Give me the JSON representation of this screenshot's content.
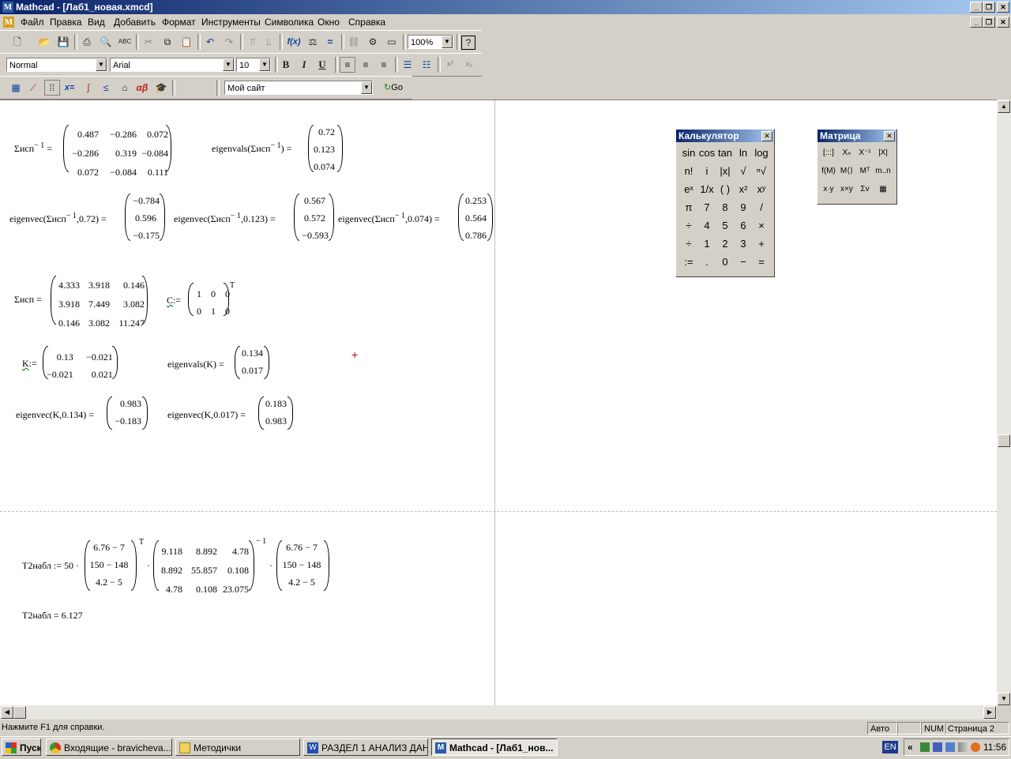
{
  "window": {
    "title": "Mathcad - [Лаб1_новая.xmcd]"
  },
  "menu": [
    "Файл",
    "Правка",
    "Вид",
    "Добавить",
    "Формат",
    "Инструменты",
    "Символика",
    "Окно",
    "Справка"
  ],
  "toolbar": {
    "zoom": "100%",
    "style": "Normal",
    "font": "Arial",
    "size": "10",
    "bold": "B",
    "italic": "I",
    "underline": "U",
    "resource": "Мой сайт",
    "go": "Go",
    "calc_glyph": "x=",
    "greek_glyph": "αβ"
  },
  "doc": {
    "sinv_label": "Σисп",
    "sinv_sup": "− 1",
    "eq": "=",
    "assign": ":=",
    "sinv_matrix": [
      [
        "0.487",
        "−0.286",
        "0.072"
      ],
      [
        "−0.286",
        "0.319",
        "−0.084"
      ],
      [
        "0.072",
        "−0.084",
        "0.111"
      ]
    ],
    "eigenvals_fn": "eigenvals",
    "eigenvals_vec": [
      "0.72",
      "0.123",
      "0.074"
    ],
    "eigenvec_fn": "eigenvec",
    "ev1_arg": ",0.72",
    "ev1_vec": [
      "−0.784",
      "0.596",
      "−0.175"
    ],
    "ev2_arg": ",0.123",
    "ev2_vec": [
      "0.567",
      "0.572",
      "−0.593"
    ],
    "ev3_arg": ",0.074",
    "ev3_vec": [
      "0.253",
      "0.564",
      "0.786"
    ],
    "s_label": "Σисп",
    "s_matrix": [
      [
        "4.333",
        "3.918",
        "0.146"
      ],
      [
        "3.918",
        "7.449",
        "3.082"
      ],
      [
        "0.146",
        "3.082",
        "11.247"
      ]
    ],
    "c_label": "C",
    "c_matrix": [
      [
        "1",
        "0",
        "0"
      ],
      [
        "0",
        "1",
        "0"
      ]
    ],
    "transpose": "T",
    "k_label": "K",
    "k_matrix": [
      [
        "0.13",
        "−0.021"
      ],
      [
        "−0.021",
        "0.021"
      ]
    ],
    "eigk_text": "eigenvals(K) =",
    "eigk_vec": [
      "0.134",
      "0.017"
    ],
    "evk1_text": "eigenvec(K,0.134) =",
    "evk1_vec": [
      "0.983",
      "−0.183"
    ],
    "evk2_text": "eigenvec(K,0.017) =",
    "evk2_vec": [
      "0.183",
      "0.983"
    ],
    "t2_label": "T2набл := 50 ·",
    "t2_v1": [
      "6.76 − 7",
      "150 − 148",
      "4.2 − 5"
    ],
    "t2_m": [
      [
        "9.118",
        "8.892",
        "4.78"
      ],
      [
        "8.892",
        "55.857",
        "0.108"
      ],
      [
        "4.78",
        "0.108",
        "23.075"
      ]
    ],
    "t2_v2": [
      "6.76 − 7",
      "150 − 148",
      "4.2 − 5"
    ],
    "dot": "·",
    "t2_result": "T2набл = 6.127"
  },
  "calc": {
    "title": "Калькулятор",
    "keys": [
      [
        "sin",
        "cos",
        "tan",
        "ln",
        "log"
      ],
      [
        "n!",
        "i",
        "|x|",
        "√",
        "ⁿ√"
      ],
      [
        "eˣ",
        "1/x",
        "( )",
        "x²",
        "xʸ"
      ],
      [
        "π",
        "7",
        "8",
        "9",
        "/"
      ],
      [
        "÷",
        "4",
        "5",
        "6",
        "×"
      ],
      [
        "÷",
        "1",
        "2",
        "3",
        "+"
      ],
      [
        ":=",
        ".",
        "0",
        "−",
        "="
      ]
    ]
  },
  "matrix_pal": {
    "title": "Матрица",
    "keys": [
      [
        "[:::]",
        "Xₙ",
        "X⁻¹",
        "|X|"
      ],
      [
        "f(M)",
        "M⟨⟩",
        "Mᵀ",
        "m..n"
      ],
      [
        "x·y",
        "x×y",
        "Σv",
        "▦"
      ]
    ]
  },
  "status": {
    "help": "Нажмите F1 для справки.",
    "mode": "Авто",
    "num": "NUM",
    "page": "Страница 2"
  },
  "taskbar": {
    "start": "Пуск",
    "tasks": [
      "Входящие - bravicheva...",
      "Методички",
      "РАЗДЕЛ 1 АНАЛИЗ ДАН...",
      "Mathcad - [Лаб1_нов..."
    ],
    "lang": "EN",
    "time": "11:56",
    "tray_chevron": "«"
  }
}
